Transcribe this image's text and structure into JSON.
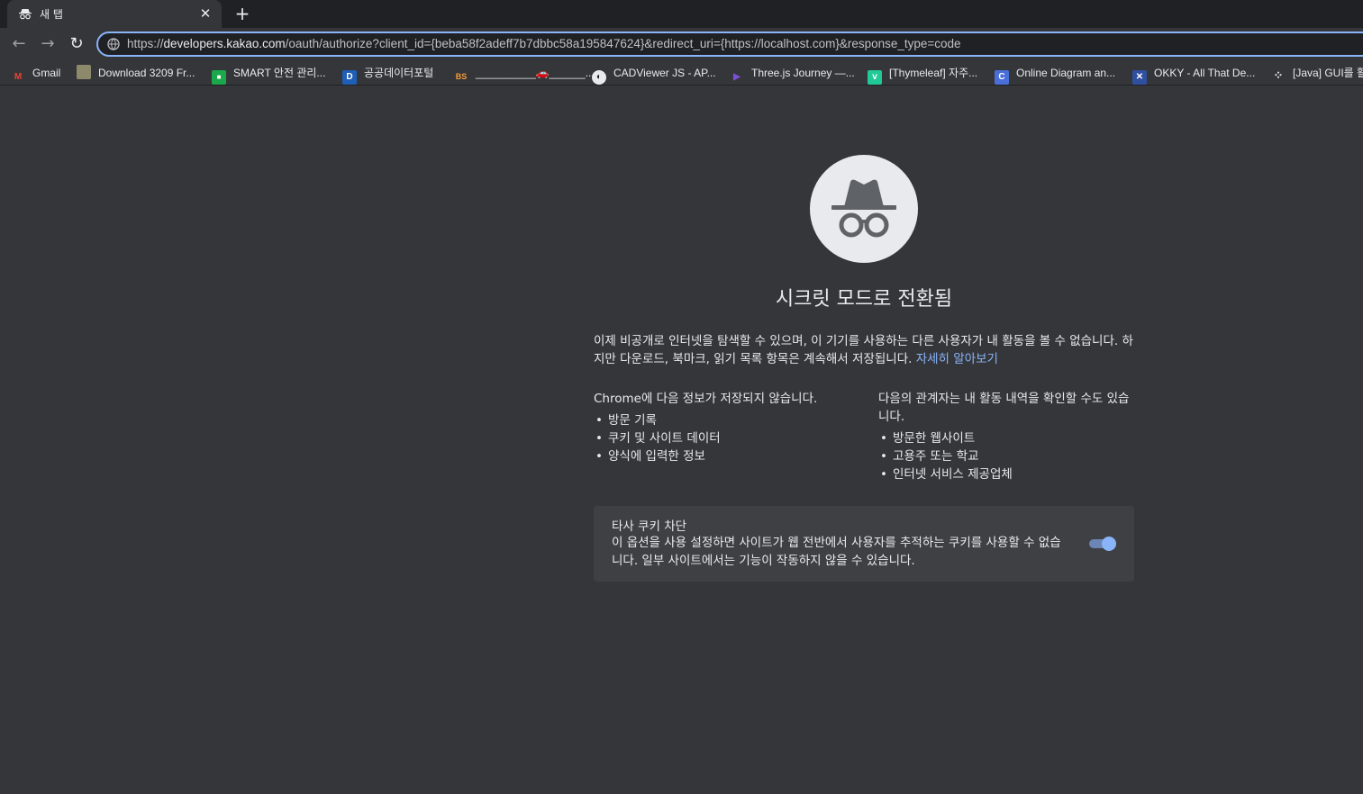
{
  "tab": {
    "title": "새 탭",
    "close_glyph": "✕",
    "new_tab_glyph": "+"
  },
  "toolbar": {
    "back_glyph": "←",
    "forward_glyph": "→",
    "reload_glyph": "↻",
    "url_prefix": "https://",
    "url_host": "developers.kakao.com",
    "url_rest": "/oauth/authorize?client_id={beba58f2adeff7b7dbbc58a195847624}&redirect_uri={https://localhost.com}&response_type=code"
  },
  "bookmarks": [
    {
      "label": "Gmail",
      "icon": "gmail-icon",
      "icon_text": "M",
      "color": "#ea4335"
    },
    {
      "label": "Download 3209 Fr...",
      "icon": "download-site-icon",
      "icon_text": "",
      "color": "#8d8a6b"
    },
    {
      "label": "SMART 안전 관리...",
      "icon": "smart-icon",
      "icon_text": "■",
      "color": "#1aa84a"
    },
    {
      "label": "공공데이터포털",
      "icon": "data-portal-icon",
      "icon_text": "D",
      "color": "#1f5fb8"
    },
    {
      "label": "__________🚗______...",
      "icon": "bs-icon",
      "icon_text": "BS",
      "color": "#f29b38"
    },
    {
      "label": "CADViewer JS - AP...",
      "icon": "cadviewer-icon",
      "icon_text": "◐",
      "color": "#202124"
    },
    {
      "label": "Three.js Journey —...",
      "icon": "threejs-icon",
      "icon_text": "▶",
      "color": "#7b4fd6"
    },
    {
      "label": "[Thymeleaf] 자주...",
      "icon": "velog-icon",
      "icon_text": "v",
      "color": "#20c997"
    },
    {
      "label": "Online Diagram an...",
      "icon": "diagram-icon",
      "icon_text": "C",
      "color": "#4a6fd8"
    },
    {
      "label": "OKKY - All That De...",
      "icon": "okky-icon",
      "icon_text": "✕",
      "color": "#2f4fa0"
    },
    {
      "label": "[Java] GUI를 활",
      "icon": "java-gui-icon",
      "icon_text": "⁘",
      "color": "#35363a"
    }
  ],
  "incognito": {
    "title": "시크릿 모드로 전환됨",
    "intro": "이제 비공개로 인터넷을 탐색할 수 있으며, 이 기기를 사용하는 다른 사용자가 내 활동을 볼 수 없습니다. 하지만 다운로드, 북마크, 읽기 목록 항목은 계속해서 저장됩니다.",
    "learn_more": "자세히 알아보기",
    "not_saved_heading": "Chrome에 다음 정보가 저장되지 않습니다.",
    "not_saved_items": [
      "방문 기록",
      "쿠키 및 사이트 데이터",
      "양식에 입력한 정보"
    ],
    "visible_heading": "다음의 관계자는 내 활동 내역을 확인할 수도 있습니다.",
    "visible_items": [
      "방문한 웹사이트",
      "고용주 또는 학교",
      "인터넷 서비스 제공업체"
    ],
    "cookie_title": "타사 쿠키 차단",
    "cookie_desc": "이 옵션을 사용 설정하면 사이트가 웹 전반에서 사용자를 추적하는 쿠키를 사용할 수 없습니다. 일부 사이트에서는 기능이 작동하지 않을 수 있습니다.",
    "cookie_toggle_on": true
  },
  "colors": {
    "accent": "#8ab4f8",
    "background": "#35363a",
    "frame": "#202124"
  }
}
